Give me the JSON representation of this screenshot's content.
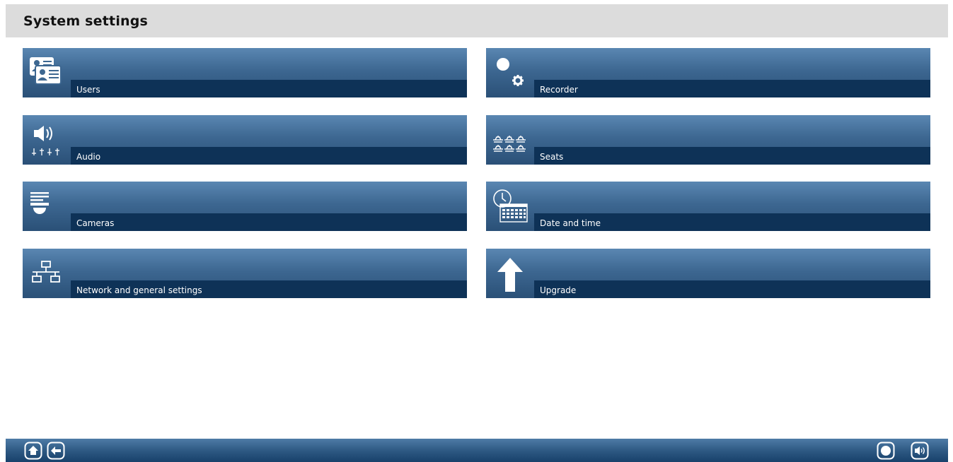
{
  "header": {
    "title": "System settings"
  },
  "tiles": [
    {
      "label": "Users",
      "icon": "users-icon"
    },
    {
      "label": "Recorder",
      "icon": "recorder-settings-icon"
    },
    {
      "label": "Audio",
      "icon": "audio-icon"
    },
    {
      "label": "Seats",
      "icon": "seats-icon"
    },
    {
      "label": "Cameras",
      "icon": "camera-icon"
    },
    {
      "label": "Date and time",
      "icon": "date-time-icon"
    },
    {
      "label": "Network and general settings",
      "icon": "network-icon"
    },
    {
      "label": "Upgrade",
      "icon": "upgrade-arrow-icon"
    }
  ],
  "footer": {
    "left_buttons": [
      "home-icon",
      "back-icon"
    ],
    "right_buttons": [
      "record-icon",
      "speaker-icon"
    ]
  },
  "colors": {
    "header_bg": "#dcdcdc",
    "tile_gradient_top": "#5a87b2",
    "tile_gradient_bottom": "#2a5077",
    "label_bar": "#0e3257",
    "footer_bg": "#2c5781"
  }
}
